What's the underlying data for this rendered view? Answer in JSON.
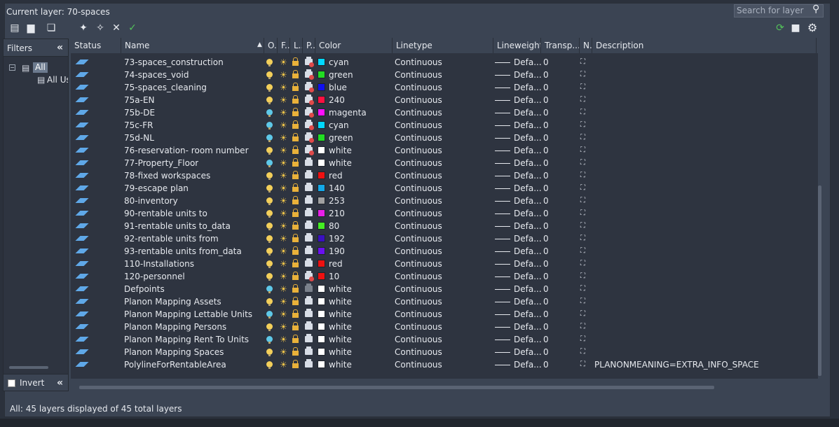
{
  "current_layer": "Current layer: 70-spaces",
  "search": {
    "placeholder": "Search for layer"
  },
  "toolbar": {
    "icons": [
      "new-property-filter-icon",
      "new-group-filter-icon",
      "layer-states-manager-icon",
      "new-layer-icon",
      "new-layer-vp-frozen-icon",
      "delete-layer-icon",
      "set-current-icon",
      "refresh-icon",
      "settings-icon"
    ]
  },
  "filters": {
    "title": "Filters",
    "tree_all": "All",
    "tree_all_used": "All Used Layers",
    "invert": "Invert"
  },
  "columns": {
    "status": "Status",
    "name": "Name",
    "on": "O..",
    "freeze": "F..",
    "lock": "L..",
    "plot": "P..",
    "color": "Color",
    "linetype": "Linetype",
    "lineweight": "Lineweight",
    "transparency": "Transp...",
    "newvp": "N..",
    "description": "Description"
  },
  "rows": [
    {
      "name": "73-spaces_construction",
      "on": true,
      "plot": false,
      "color": "cyan",
      "hex": "#00d8ff",
      "linetype": "Continuous",
      "lineweight": "Defa...",
      "transp": "0",
      "desc": ""
    },
    {
      "name": "74-spaces_void",
      "on": true,
      "plot": false,
      "color": "green",
      "hex": "#22dd22",
      "linetype": "Continuous",
      "lineweight": "Defa...",
      "transp": "0",
      "desc": ""
    },
    {
      "name": "75-spaces_cleaning",
      "on": true,
      "plot": false,
      "color": "blue",
      "hex": "#1010f0",
      "linetype": "Continuous",
      "lineweight": "Defa...",
      "transp": "0",
      "desc": ""
    },
    {
      "name": "75a-EN",
      "on": true,
      "plot": false,
      "color": "240",
      "hex": "#ff1040",
      "linetype": "Continuous",
      "lineweight": "Defa...",
      "transp": "0",
      "desc": ""
    },
    {
      "name": "75b-DE",
      "on": false,
      "plot": false,
      "color": "magenta",
      "hex": "#ff10ff",
      "linetype": "Continuous",
      "lineweight": "Defa...",
      "transp": "0",
      "desc": ""
    },
    {
      "name": "75c-FR",
      "on": false,
      "plot": false,
      "color": "cyan",
      "hex": "#00d8ff",
      "linetype": "Continuous",
      "lineweight": "Defa...",
      "transp": "0",
      "desc": ""
    },
    {
      "name": "75d-NL",
      "on": false,
      "plot": false,
      "color": "green",
      "hex": "#22dd22",
      "linetype": "Continuous",
      "lineweight": "Defa...",
      "transp": "0",
      "desc": ""
    },
    {
      "name": "76-reservation- room number",
      "on": true,
      "plot": false,
      "color": "white",
      "hex": "#ffffff",
      "linetype": "Continuous",
      "lineweight": "Defa...",
      "transp": "0",
      "desc": ""
    },
    {
      "name": "77-Property_Floor",
      "on": false,
      "plot": true,
      "color": "white",
      "hex": "#ffffff",
      "linetype": "Continuous",
      "lineweight": "Defa...",
      "transp": "0",
      "desc": ""
    },
    {
      "name": "78-fixed workspaces",
      "on": true,
      "plot": true,
      "color": "red",
      "hex": "#ee1111",
      "linetype": "Continuous",
      "lineweight": "Defa...",
      "transp": "0",
      "desc": ""
    },
    {
      "name": "79-escape plan",
      "on": true,
      "plot": true,
      "color": "140",
      "hex": "#14a8e8",
      "linetype": "Continuous",
      "lineweight": "Defa...",
      "transp": "0",
      "desc": ""
    },
    {
      "name": "80-inventory",
      "on": true,
      "plot": true,
      "color": "253",
      "hex": "#a0a0a0",
      "linetype": "Continuous",
      "lineweight": "Defa...",
      "transp": "0",
      "desc": ""
    },
    {
      "name": "90-rentable units to",
      "on": true,
      "plot": true,
      "color": "210",
      "hex": "#e820e8",
      "linetype": "Continuous",
      "lineweight": "Defa...",
      "transp": "0",
      "desc": ""
    },
    {
      "name": "91-rentable units to_data",
      "on": true,
      "plot": true,
      "color": "80",
      "hex": "#44ee22",
      "linetype": "Continuous",
      "lineweight": "Defa...",
      "transp": "0",
      "desc": ""
    },
    {
      "name": "92-rentable units from",
      "on": true,
      "plot": true,
      "color": "192",
      "hex": "#3a10c0",
      "linetype": "Continuous",
      "lineweight": "Defa...",
      "transp": "0",
      "desc": ""
    },
    {
      "name": "93-rentable units from_data",
      "on": true,
      "plot": true,
      "color": "190",
      "hex": "#6a10f0",
      "linetype": "Continuous",
      "lineweight": "Defa...",
      "transp": "0",
      "desc": ""
    },
    {
      "name": "110-Installations",
      "on": true,
      "plot": true,
      "color": "red",
      "hex": "#ee1111",
      "linetype": "Continuous",
      "lineweight": "Defa...",
      "transp": "0",
      "desc": ""
    },
    {
      "name": "120-personnel",
      "on": true,
      "plot": false,
      "color": "10",
      "hex": "#ee1111",
      "linetype": "Continuous",
      "lineweight": "Defa...",
      "transp": "0",
      "desc": ""
    },
    {
      "name": "Defpoints",
      "on": false,
      "plot": "disabled",
      "color": "white",
      "hex": "#ffffff",
      "linetype": "Continuous",
      "lineweight": "Defa...",
      "transp": "0",
      "desc": ""
    },
    {
      "name": "Planon Mapping Assets",
      "on": true,
      "plot": true,
      "color": "white",
      "hex": "#ffffff",
      "linetype": "Continuous",
      "lineweight": "Defa...",
      "transp": "0",
      "desc": ""
    },
    {
      "name": "Planon Mapping Lettable Units",
      "on": false,
      "plot": true,
      "color": "white",
      "hex": "#ffffff",
      "linetype": "Continuous",
      "lineweight": "Defa...",
      "transp": "0",
      "desc": ""
    },
    {
      "name": "Planon Mapping Persons",
      "on": true,
      "plot": true,
      "color": "white",
      "hex": "#ffffff",
      "linetype": "Continuous",
      "lineweight": "Defa...",
      "transp": "0",
      "desc": ""
    },
    {
      "name": "Planon Mapping Rent To Units",
      "on": false,
      "plot": true,
      "color": "white",
      "hex": "#ffffff",
      "linetype": "Continuous",
      "lineweight": "Defa...",
      "transp": "0",
      "desc": ""
    },
    {
      "name": "Planon Mapping Spaces",
      "on": true,
      "plot": true,
      "color": "white",
      "hex": "#ffffff",
      "linetype": "Continuous",
      "lineweight": "Defa...",
      "transp": "0",
      "desc": ""
    },
    {
      "name": "PolylineForRentableArea",
      "on": true,
      "plot": true,
      "color": "white",
      "hex": "#ffffff",
      "linetype": "Continuous",
      "lineweight": "Defa...",
      "transp": "0",
      "desc": "PLANONMEANING=EXTRA_INFO_SPACE"
    }
  ],
  "colors": {
    "bulb_on": "#f3cf5a",
    "bulb_off": "#5ec8e8"
  },
  "status_bar": "All: 45 layers displayed of 45 total layers"
}
